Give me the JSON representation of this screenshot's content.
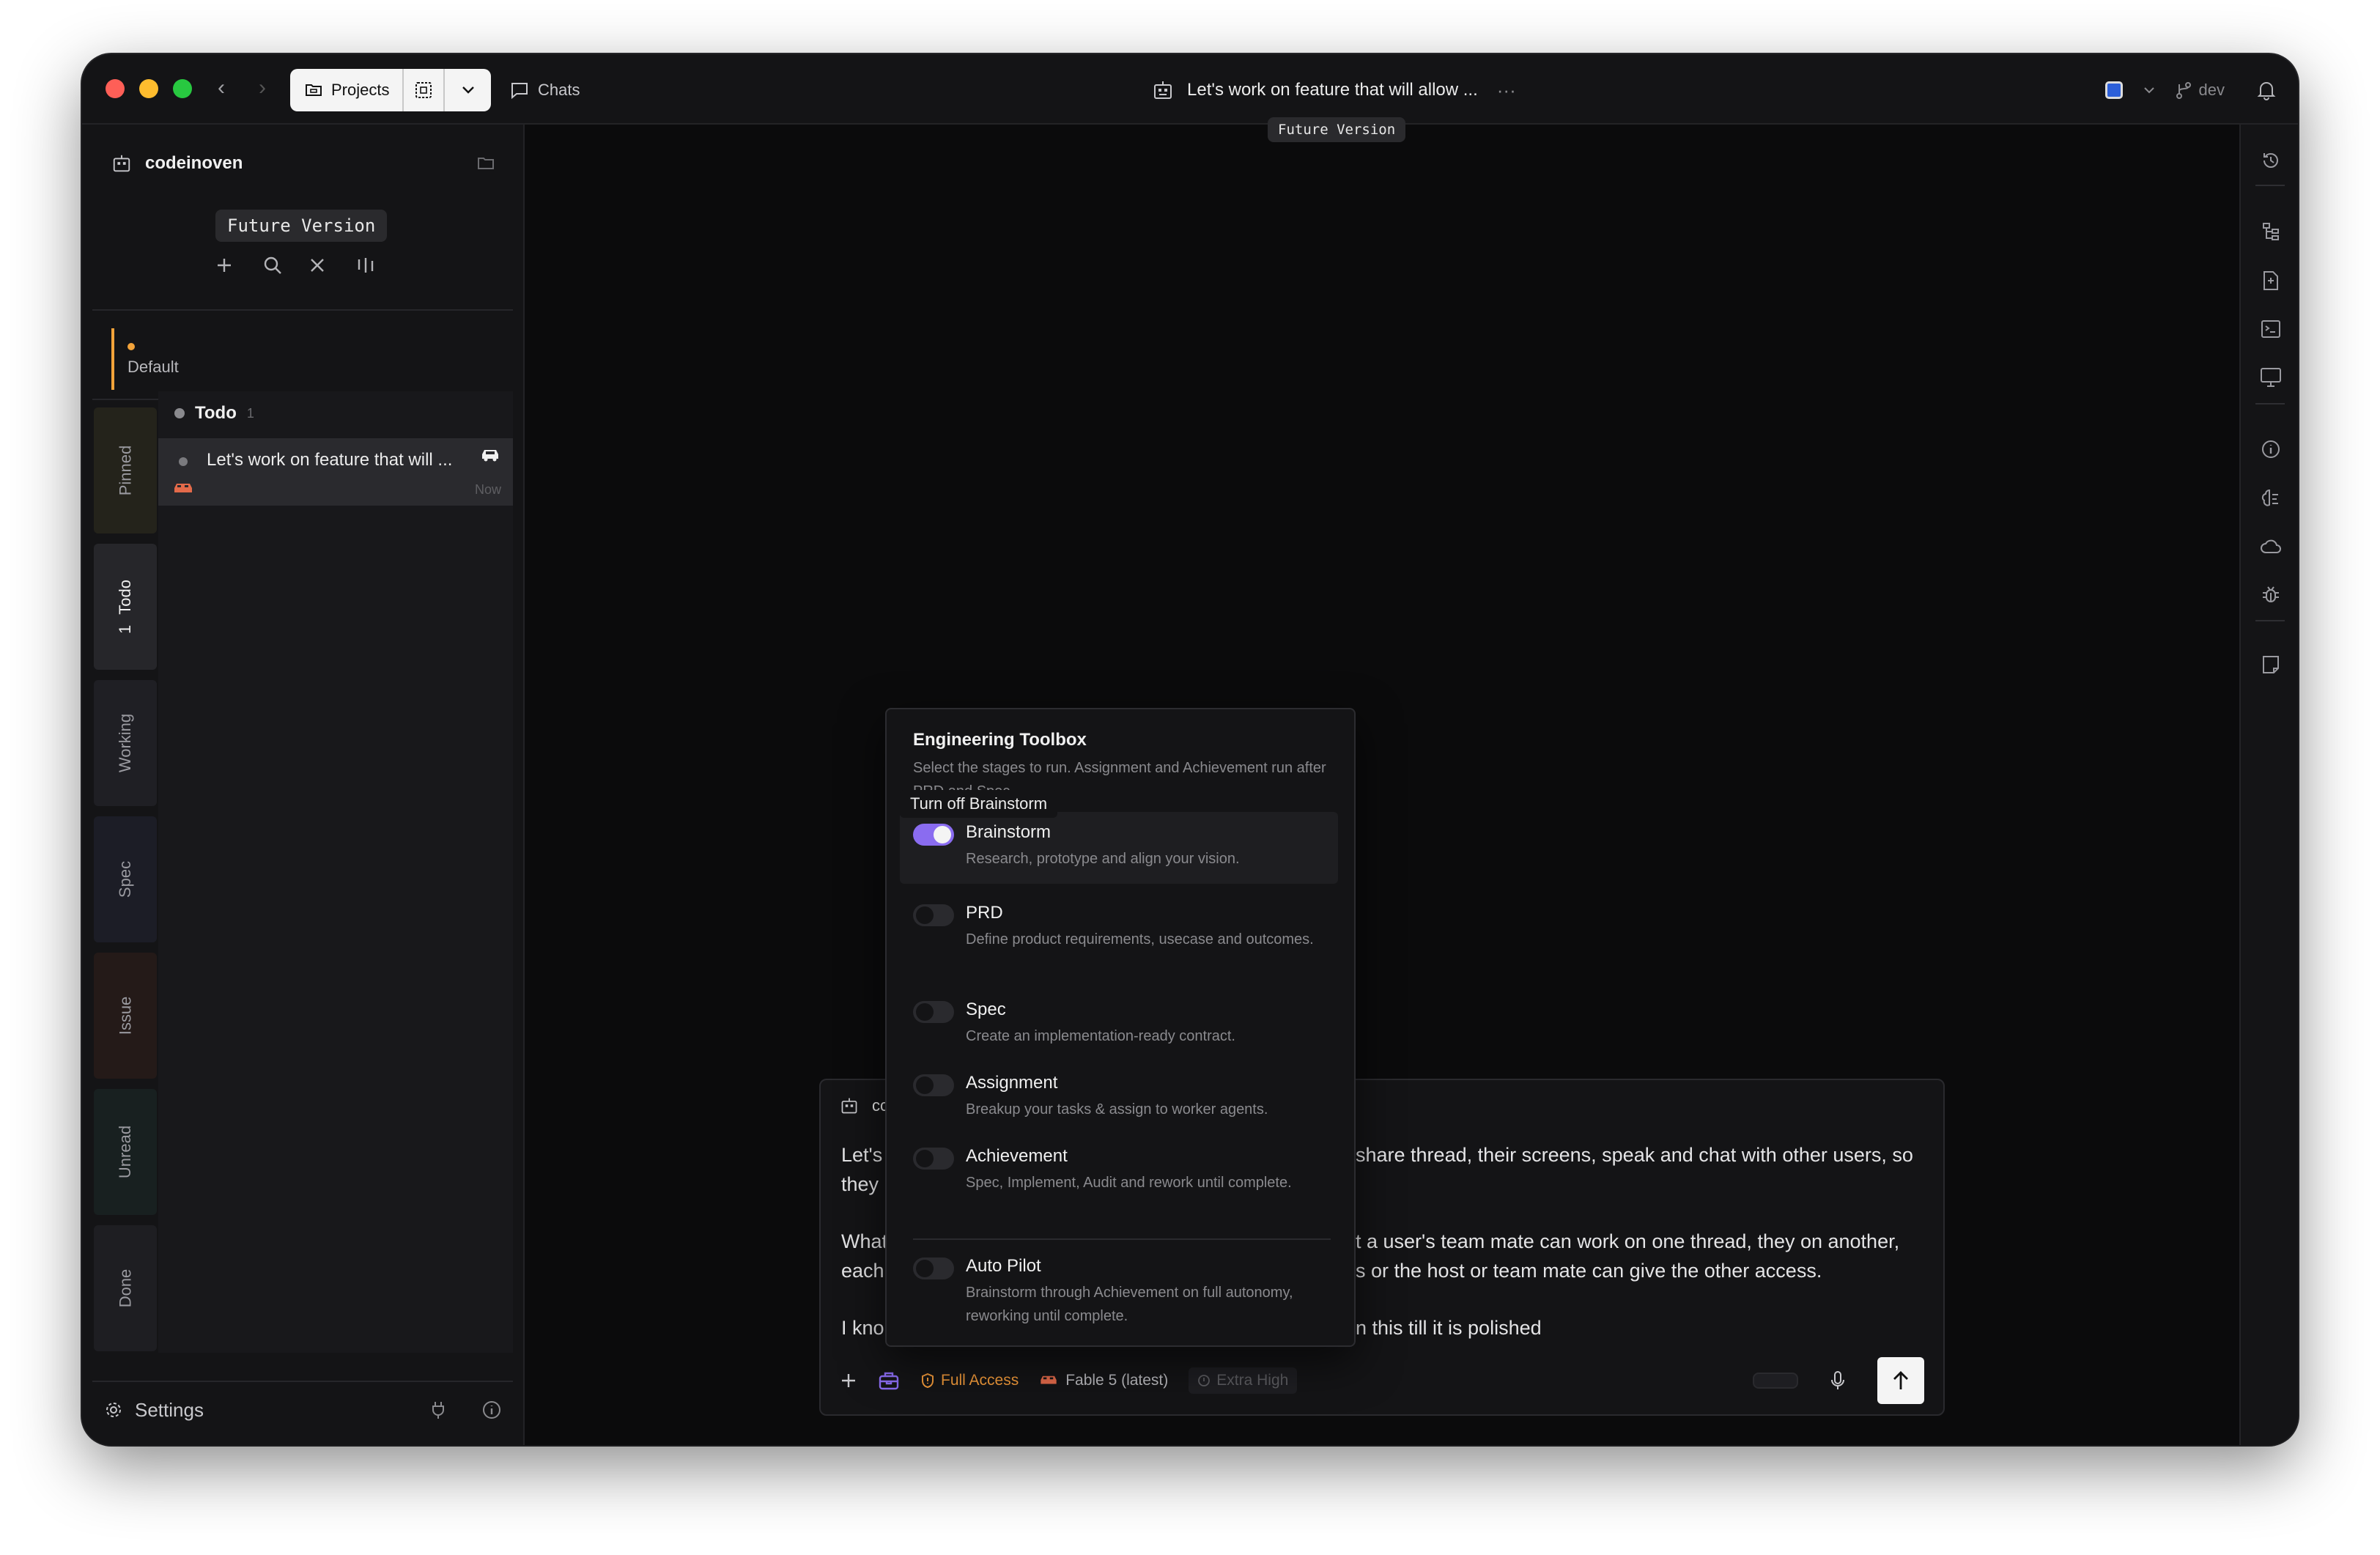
{
  "titlebar": {
    "projects_label": "Projects",
    "chats_label": "Chats",
    "thread_title": "Let's work on feature that will allow ...",
    "more_glyph": "···",
    "future_tooltip": "Future Version",
    "branch_label": "dev"
  },
  "sidebar": {
    "workspace_name": "codeinoven",
    "future_badge": "Future Version",
    "default_label": "Default",
    "tabs": [
      {
        "label": "Pinned",
        "count": ""
      },
      {
        "label": "Todo",
        "count": "1"
      },
      {
        "label": "Working",
        "count": ""
      },
      {
        "label": "Spec",
        "count": ""
      },
      {
        "label": "Issue",
        "count": ""
      },
      {
        "label": "Unread",
        "count": ""
      },
      {
        "label": "Done",
        "count": ""
      }
    ],
    "group": {
      "label": "Todo",
      "count": "1"
    },
    "thread": {
      "title": "Let's work on feature that will ...",
      "time": "Now"
    },
    "settings_label": "Settings"
  },
  "popover": {
    "title": "Engineering Toolbox",
    "subtitle": "Select the stages to run. Assignment and Achievement run after PRD and Spec.",
    "tooltip": "Turn off Brainstorm",
    "stages": [
      {
        "name": "Brainstorm",
        "desc": "Research, prototype and align your vision.",
        "on": true
      },
      {
        "name": "PRD",
        "desc": "Define product requirements, usecase and outcomes.",
        "on": false
      },
      {
        "name": "Spec",
        "desc": "Create an implementation-ready contract.",
        "on": false
      },
      {
        "name": "Assignment",
        "desc": "Breakup your tasks & assign to worker agents.",
        "on": false
      },
      {
        "name": "Achievement",
        "desc": "Spec, Implement, Audit and rework until complete.",
        "on": false
      },
      {
        "name": "Auto Pilot",
        "desc": "Brainstorm through Achievement on full autonomy, reworking until complete.",
        "on": false
      }
    ]
  },
  "composer": {
    "workspace": "codeinoven",
    "paragraph_1a": "Let's",
    "paragraph_1b": "share thread, their screens, speak and chat with other users, so",
    "paragraph_1c": "they",
    "paragraph_2a": "What",
    "paragraph_2b": "t a user's team mate can work on one thread, they on another,",
    "paragraph_2c": "each",
    "paragraph_2d": "s or the host or team mate can give the other access.",
    "paragraph_3a": "I kno",
    "paragraph_3b": "n this till it is polished",
    "access_label": "Full Access",
    "model_label": "Fable 5 (latest)",
    "effort_label": "Extra High"
  },
  "colors": {
    "accent_purple": "#8a6cf0",
    "warning_orange": "#f29a3a",
    "background": "#0b0b0c"
  }
}
